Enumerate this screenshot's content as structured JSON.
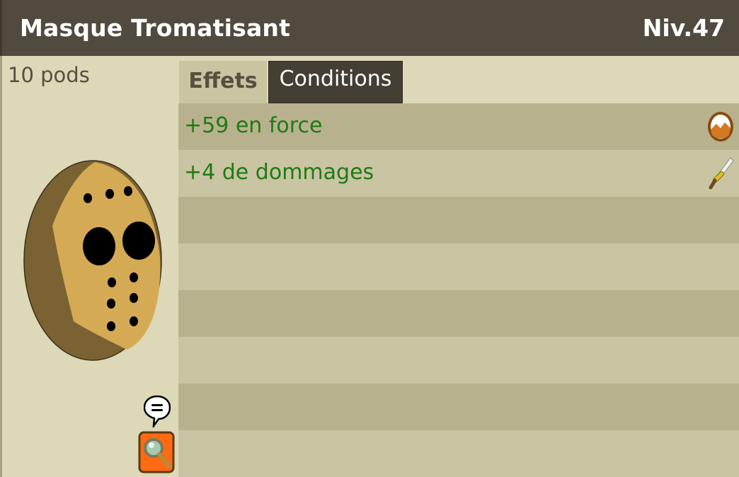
{
  "item": {
    "name": "Masque Tromatisant",
    "level": "Niv.47",
    "weight": "10 pods"
  },
  "tabs": [
    {
      "label": "Effets",
      "active": true
    },
    {
      "label": "Conditions",
      "active": false
    }
  ],
  "effects": [
    {
      "text": "+59 en force",
      "icon": "strength-icon"
    },
    {
      "text": "+4 de dommages",
      "icon": "damage-sword-icon"
    }
  ],
  "colors": {
    "titlebar": "#514a3e",
    "background": "#dcd8b8",
    "row_dark": "#b8b18e",
    "row_light": "#c9c4a2",
    "effect_text": "#1f7a16",
    "tab_inactive": "#453e33"
  }
}
